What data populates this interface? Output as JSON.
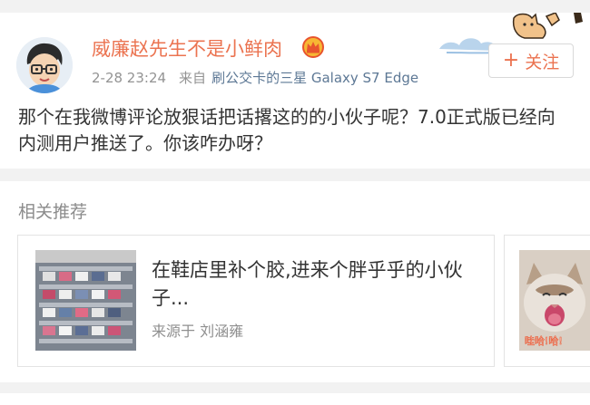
{
  "post": {
    "author_name": "威廉赵先生不是小鲜肉",
    "timestamp": "2-28 23:24",
    "from_label": "来自",
    "device": "刷公交卡的三星 Galaxy S7 Edge",
    "follow_label": "关注",
    "follow_icon": "plus-icon",
    "text": "那个在我微博评论放狠话把话撂这的的小伙子呢？7.0正式版已经向内测用户推送了。你该咋办呀？"
  },
  "recommend": {
    "section_title": "相关推荐",
    "items": [
      {
        "title": "在鞋店里补个胶,进来个胖乎乎的小伙子...",
        "source": "来源于 刘涵雍"
      }
    ]
  },
  "colors": {
    "accent": "#eb7350",
    "link_blue": "#5d7895"
  }
}
